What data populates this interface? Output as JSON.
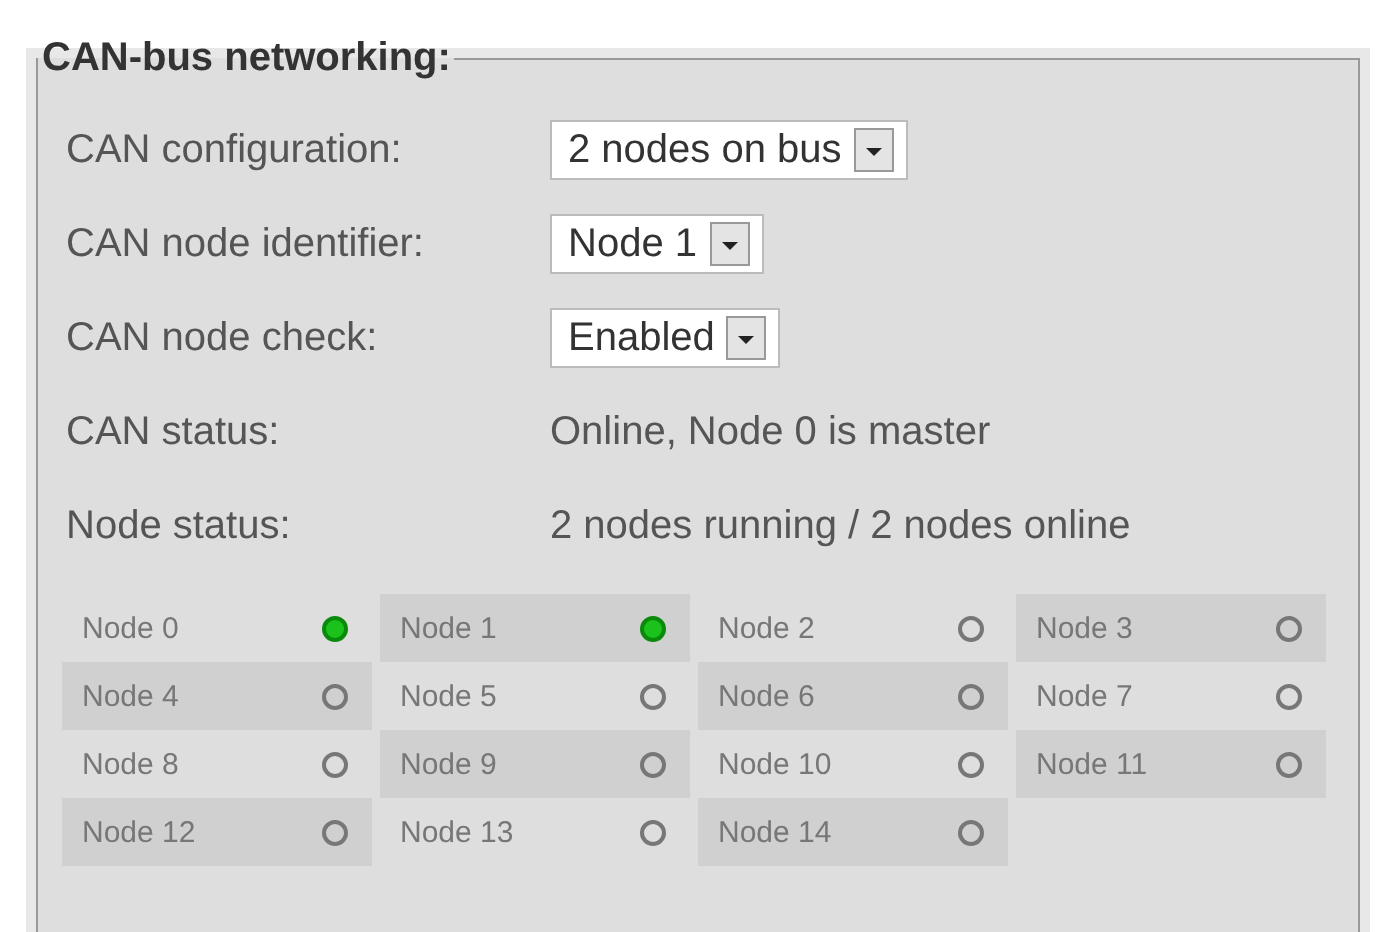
{
  "title": "CAN-bus networking:",
  "fields": [
    {
      "label": "CAN configuration:",
      "kind": "select",
      "value": "2 nodes on bus"
    },
    {
      "label": "CAN node identifier:",
      "kind": "select",
      "value": "Node 1"
    },
    {
      "label": "CAN node check:",
      "kind": "select",
      "value": "Enabled"
    },
    {
      "label": "CAN status:",
      "kind": "text",
      "value": "Online, Node 0 is master"
    },
    {
      "label": "Node status:",
      "kind": "text",
      "value": "2 nodes running / 2 nodes online"
    }
  ],
  "nodes": [
    {
      "name": "Node 0",
      "online": true
    },
    {
      "name": "Node 1",
      "online": true
    },
    {
      "name": "Node 2",
      "online": false
    },
    {
      "name": "Node 3",
      "online": false
    },
    {
      "name": "Node 4",
      "online": false
    },
    {
      "name": "Node 5",
      "online": false
    },
    {
      "name": "Node 6",
      "online": false
    },
    {
      "name": "Node 7",
      "online": false
    },
    {
      "name": "Node 8",
      "online": false
    },
    {
      "name": "Node 9",
      "online": false
    },
    {
      "name": "Node 10",
      "online": false
    },
    {
      "name": "Node 11",
      "online": false
    },
    {
      "name": "Node 12",
      "online": false
    },
    {
      "name": "Node 13",
      "online": false
    },
    {
      "name": "Node 14",
      "online": false
    }
  ]
}
